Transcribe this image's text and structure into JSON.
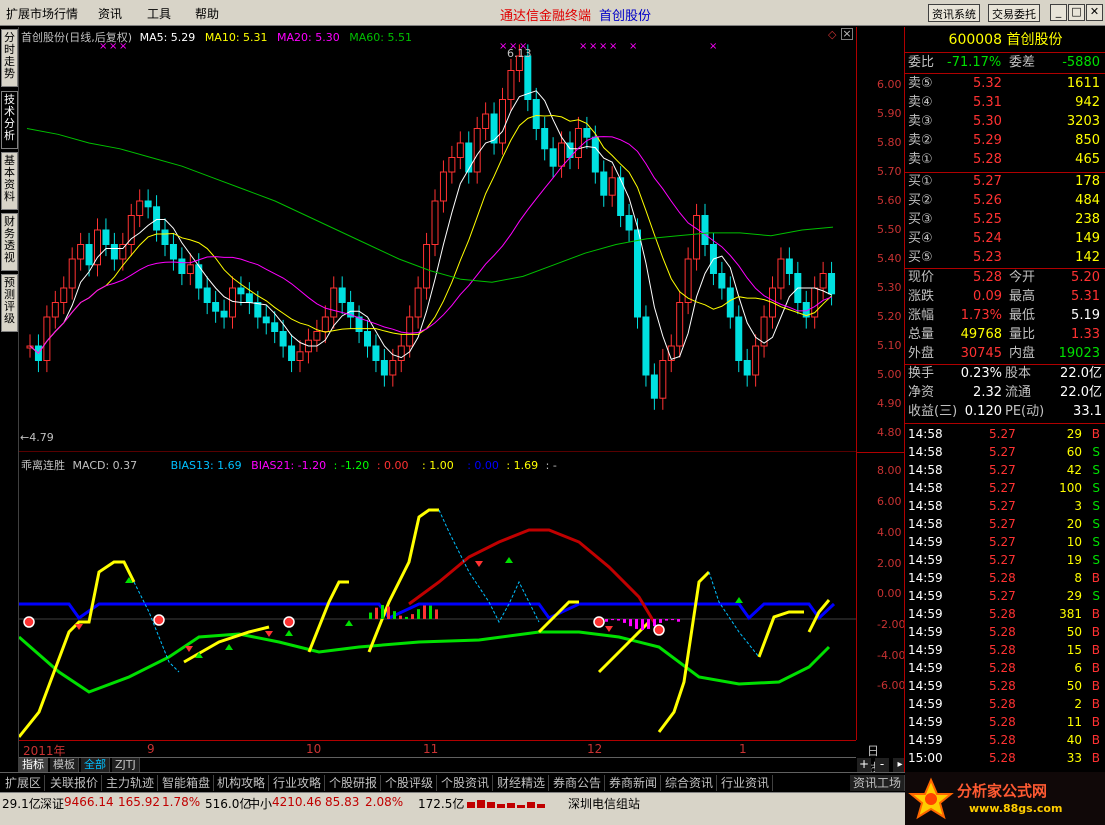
{
  "menubar": {
    "items": [
      "扩展市场行情",
      "资讯",
      "工具",
      "帮助"
    ],
    "title_app": "通达信金融终端",
    "title_stock": "首创股份",
    "btn_news": "资讯系统",
    "btn_trade": "交易委托",
    "win_min": "_",
    "win_max": "□",
    "win_close": "✕"
  },
  "left_tabs": [
    "分时走势",
    "技术分析",
    "基本资料",
    "财务透视",
    "预测评级"
  ],
  "main_chart": {
    "header": {
      "name": "首创股份(日线,后复权)",
      "ma5": "MA5: 5.29",
      "ma10": "MA10: 5.31",
      "ma20": "MA20: 5.30",
      "ma60": "MA60: 5.51"
    },
    "high_label": "6.13",
    "low_label": "←4.79",
    "y_axis": [
      "6.00",
      "5.90",
      "5.80",
      "5.70",
      "5.60",
      "5.50",
      "5.40",
      "5.30",
      "5.20",
      "5.10",
      "5.00",
      "4.90",
      "4.80"
    ]
  },
  "indicator": {
    "name": "乖离连胜",
    "macd": "MACD: 0.37",
    "bias13": "BIAS13: 1.69",
    "bias21": "BIAS21: -1.20",
    "v1": ": -1.20",
    "v2": ": 0.00",
    "v3": ": 1.00",
    "v4": ": 0.00",
    "v5": ": 1.69",
    "v6": ": -",
    "y_axis": [
      "8.00",
      "6.00",
      "4.00",
      "2.00",
      "0.00",
      "-2.00",
      "-4.00",
      "-6.00"
    ]
  },
  "time_axis": {
    "labels": [
      "2011年",
      "9",
      "10",
      "11",
      "12",
      "1"
    ],
    "period": "日线"
  },
  "sub_tabs": [
    "指标",
    "模板",
    "全部",
    "ZJTJ"
  ],
  "quote": {
    "code_name": "600008 首创股份",
    "wei_bi_label": "委比",
    "wei_bi": "-71.17%",
    "wei_cha_label": "委差",
    "wei_cha": "-5880",
    "sell": [
      {
        "label": "卖⑤",
        "price": "5.32",
        "vol": "1611"
      },
      {
        "label": "卖④",
        "price": "5.31",
        "vol": "942"
      },
      {
        "label": "卖③",
        "price": "5.30",
        "vol": "3203"
      },
      {
        "label": "卖②",
        "price": "5.29",
        "vol": "850"
      },
      {
        "label": "卖①",
        "price": "5.28",
        "vol": "465"
      }
    ],
    "buy": [
      {
        "label": "买①",
        "price": "5.27",
        "vol": "178"
      },
      {
        "label": "买②",
        "price": "5.26",
        "vol": "484"
      },
      {
        "label": "买③",
        "price": "5.25",
        "vol": "238"
      },
      {
        "label": "买④",
        "price": "5.24",
        "vol": "149"
      },
      {
        "label": "买⑤",
        "price": "5.23",
        "vol": "142"
      }
    ],
    "stats": [
      {
        "l1": "现价",
        "v1": "5.28",
        "l2": "今开",
        "v2": "5.20"
      },
      {
        "l1": "涨跌",
        "v1": "0.09",
        "l2": "最高",
        "v2": "5.31"
      },
      {
        "l1": "涨幅",
        "v1": "1.73%",
        "l2": "最低",
        "v2": "5.19"
      },
      {
        "l1": "总量",
        "v1": "49768",
        "l2": "量比",
        "v2": "1.33"
      },
      {
        "l1": "外盘",
        "v1": "30745",
        "l2": "内盘",
        "v2": "19023"
      }
    ],
    "fund": [
      {
        "l1": "换手",
        "v1": "0.23%",
        "l2": "股本",
        "v2": "22.0亿"
      },
      {
        "l1": "净资",
        "v1": "2.32",
        "l2": "流通",
        "v2": "22.0亿"
      },
      {
        "l1": "收益(三)",
        "v1": "0.120",
        "l2": "PE(动)",
        "v2": "33.1"
      }
    ],
    "ticks": [
      {
        "t": "14:58",
        "p": "5.27",
        "v": "29",
        "d": "B"
      },
      {
        "t": "14:58",
        "p": "5.27",
        "v": "60",
        "d": "S"
      },
      {
        "t": "14:58",
        "p": "5.27",
        "v": "42",
        "d": "S"
      },
      {
        "t": "14:58",
        "p": "5.27",
        "v": "100",
        "d": "S"
      },
      {
        "t": "14:58",
        "p": "5.27",
        "v": "3",
        "d": "S"
      },
      {
        "t": "14:58",
        "p": "5.27",
        "v": "20",
        "d": "S"
      },
      {
        "t": "14:59",
        "p": "5.27",
        "v": "10",
        "d": "S"
      },
      {
        "t": "14:59",
        "p": "5.27",
        "v": "19",
        "d": "S"
      },
      {
        "t": "14:59",
        "p": "5.28",
        "v": "8",
        "d": "B"
      },
      {
        "t": "14:59",
        "p": "5.27",
        "v": "29",
        "d": "S"
      },
      {
        "t": "14:59",
        "p": "5.28",
        "v": "381",
        "d": "B"
      },
      {
        "t": "14:59",
        "p": "5.28",
        "v": "50",
        "d": "B"
      },
      {
        "t": "14:59",
        "p": "5.28",
        "v": "15",
        "d": "B"
      },
      {
        "t": "14:59",
        "p": "5.28",
        "v": "6",
        "d": "B"
      },
      {
        "t": "14:59",
        "p": "5.28",
        "v": "50",
        "d": "B"
      },
      {
        "t": "14:59",
        "p": "5.28",
        "v": "2",
        "d": "B"
      },
      {
        "t": "14:59",
        "p": "5.28",
        "v": "11",
        "d": "B"
      },
      {
        "t": "14:59",
        "p": "5.28",
        "v": "40",
        "d": "B"
      },
      {
        "t": "15:00",
        "p": "5.28",
        "v": "33",
        "d": "B"
      }
    ]
  },
  "bottom_tabs": [
    "扩展区",
    "关联报价",
    "主力轨迹",
    "智能箱盘",
    "机构攻略",
    "行业攻略",
    "个股研报",
    "个股评级",
    "个股资讯",
    "财经精选",
    "券商公告",
    "券商新闻",
    "综合资讯",
    "行业资讯"
  ],
  "bottom_right_tab": "资讯工场",
  "status": {
    "a": "29.1亿",
    "sz_label": "深证",
    "sz_val": "9466.14",
    "sz_chg": "165.92",
    "sz_pct": "1.78%",
    "amt1": "516.0亿",
    "zx_label": "中小",
    "zx_val": "4210.46",
    "zx_chg": "85.83",
    "zx_pct": "2.08%",
    "amt2": "172.5亿",
    "server": "深圳电信组站"
  },
  "logo": {
    "name": "分析家公式网",
    "url": "www.88gs.com"
  },
  "colors": {
    "up": "#ff3232",
    "down": "#00e0e0",
    "ma5": "#ffffff",
    "ma10": "#ffff00",
    "ma20": "#ff00ff",
    "ma60": "#00c000"
  }
}
